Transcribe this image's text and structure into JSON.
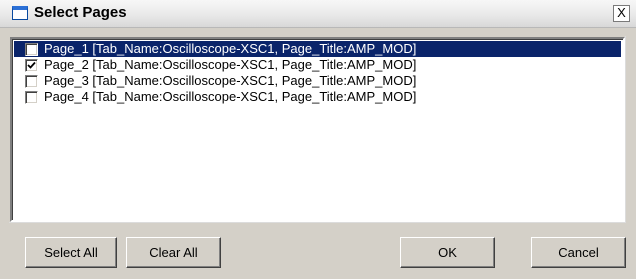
{
  "window": {
    "title": "Select Pages",
    "close_label": "X"
  },
  "pages": [
    {
      "label": "Page_1 [Tab_Name:Oscilloscope-XSC1, Page_Title:AMP_MOD]",
      "checked": false,
      "selected": true
    },
    {
      "label": "Page_2 [Tab_Name:Oscilloscope-XSC1, Page_Title:AMP_MOD]",
      "checked": true,
      "selected": false
    },
    {
      "label": "Page_3 [Tab_Name:Oscilloscope-XSC1, Page_Title:AMP_MOD]",
      "checked": false,
      "selected": false
    },
    {
      "label": "Page_4 [Tab_Name:Oscilloscope-XSC1, Page_Title:AMP_MOD]",
      "checked": false,
      "selected": false
    }
  ],
  "buttons": {
    "select_all": "Select All",
    "clear_all": "Clear All",
    "ok": "OK",
    "cancel": "Cancel"
  },
  "colors": {
    "selection": "#0a246a",
    "dialog_face": "#d4d0c8"
  }
}
